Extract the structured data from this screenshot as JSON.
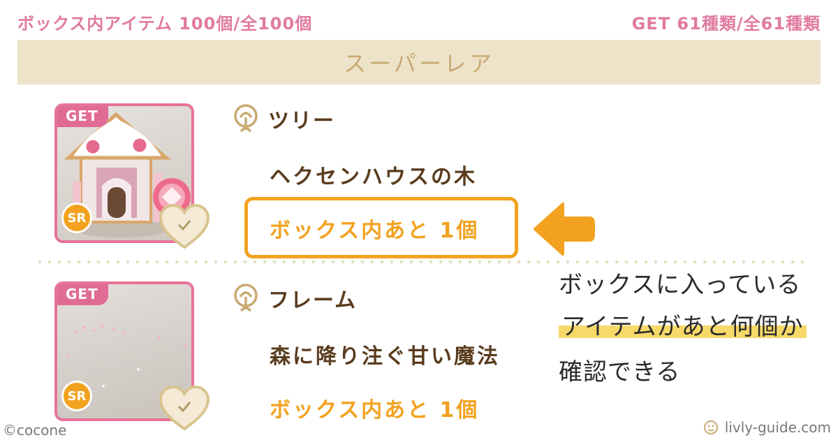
{
  "header": {
    "box_items": "ボックス内アイテム 100個/全100個",
    "get_count": "GET 61種類/全61種類"
  },
  "rarity": {
    "label": "スーパーレア"
  },
  "items": [
    {
      "get_tag": "GET",
      "rarity_badge": "SR",
      "category_icon": "tree-icon",
      "category": "ツリー",
      "name": "ヘクセンハウスの木",
      "remaining": "ボックス内あと 1個"
    },
    {
      "get_tag": "GET",
      "rarity_badge": "SR",
      "category_icon": "tree-icon",
      "category": "フレーム",
      "name": "森に降り注ぐ甘い魔法",
      "remaining": "ボックス内あと 1個"
    }
  ],
  "annotation": {
    "line1": "ボックスに入っている",
    "line2": "アイテムがあと何個か",
    "line3": "確認できる"
  },
  "footer": {
    "copyright": "©cocone",
    "site": "livly-guide.com"
  },
  "colors": {
    "accent_pink": "#e07aa0",
    "accent_orange": "#f2a21f",
    "rarity_bar": "#ede3c8",
    "text_brown": "#5a3c1e"
  }
}
